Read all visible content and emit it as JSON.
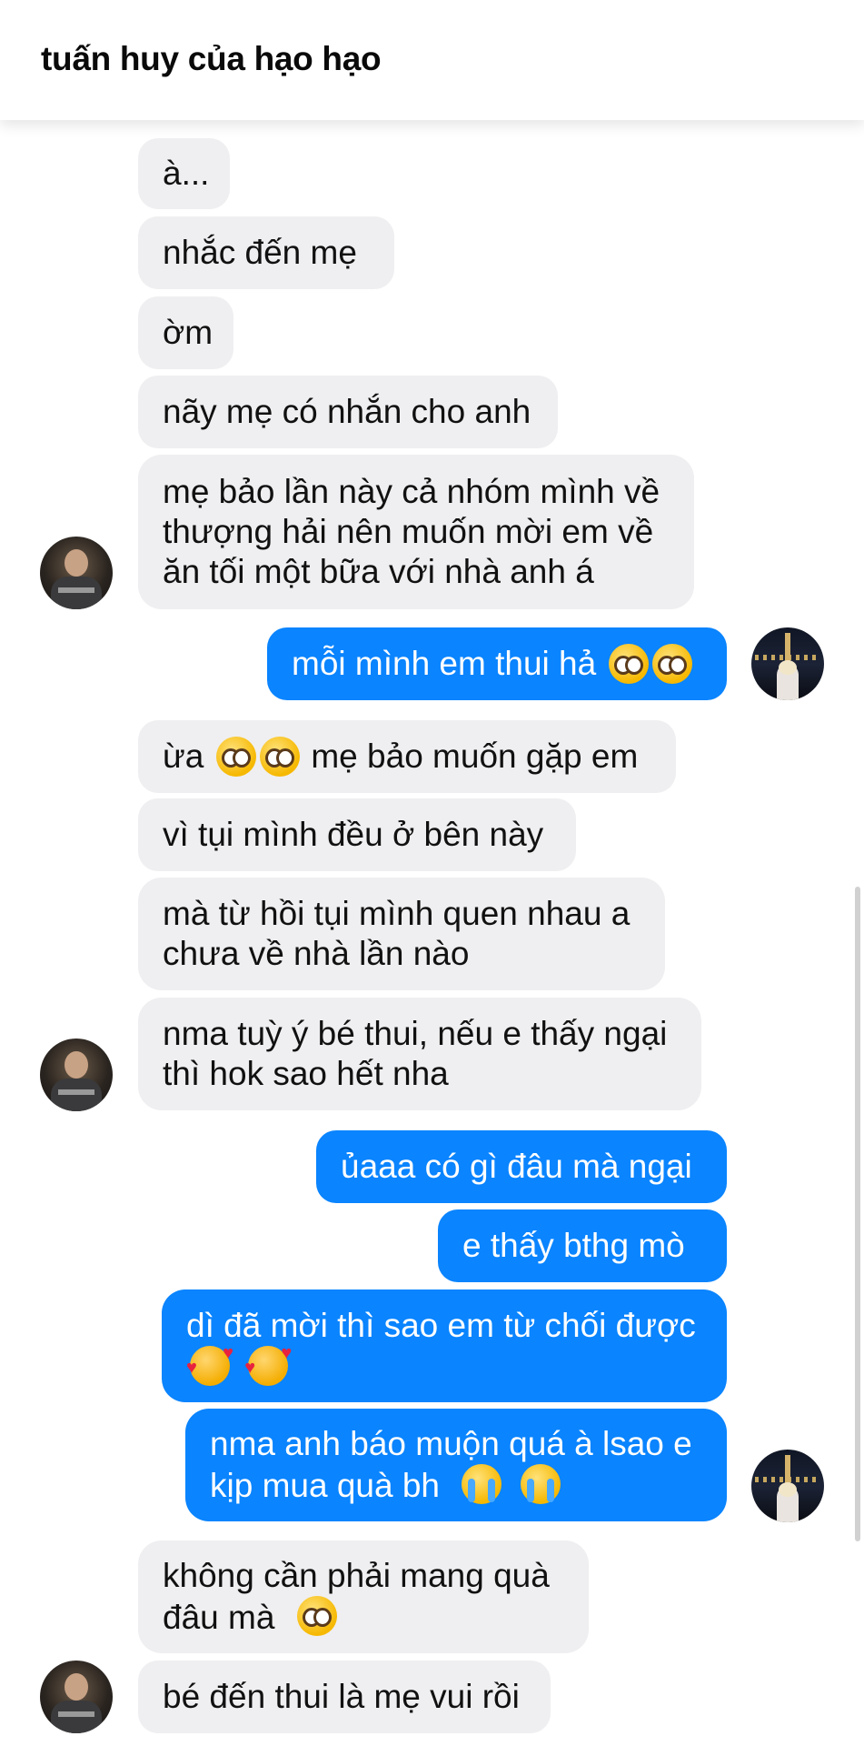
{
  "header": {
    "title": "tuấn huy của hạo hạo"
  },
  "messages": {
    "m1": "à...",
    "m2": "nhắc đến mẹ",
    "m3": "ờm",
    "m4": "nãy mẹ có nhắn cho anh",
    "m5_l1": "mẹ bảo lần này cả nhóm mình về",
    "m5_l2": "thượng hải nên muốn mời em về",
    "m5_l3": "ăn tối một bữa với nhà anh á",
    "m6": "mỗi mình em thui hả",
    "m7_a": "ừa",
    "m7_b": "mẹ bảo muốn gặp em",
    "m8": "vì tụi mình đều ở bên này",
    "m9_l1": "mà từ hồi tụi mình quen nhau a",
    "m9_l2": "chưa về nhà lần nào",
    "m10_l1": "nma tuỳ ý bé thui, nếu e thấy ngại",
    "m10_l2": "thì hok sao hết nha",
    "m11": "ủaaa có gì đâu mà ngại",
    "m12": "e thấy bthg mò",
    "m13": "dì đã mời thì sao em từ chối được",
    "m14_l1": "nma anh báo muộn quá à lsao e",
    "m14_l2": "kịp mua quà bh",
    "m15_l1": "không cần phải mang quà",
    "m15_l2": "đâu mà",
    "m16": "bé đến thui là mẹ vui rồi"
  },
  "icons": {
    "pleading": "pleading-face-emoji",
    "hearts": "smiling-face-with-hearts-emoji",
    "crying": "loudly-crying-face-emoji"
  },
  "colors": {
    "incoming_bubble": "#efeff1",
    "outgoing_bubble": "#0a84ff"
  }
}
